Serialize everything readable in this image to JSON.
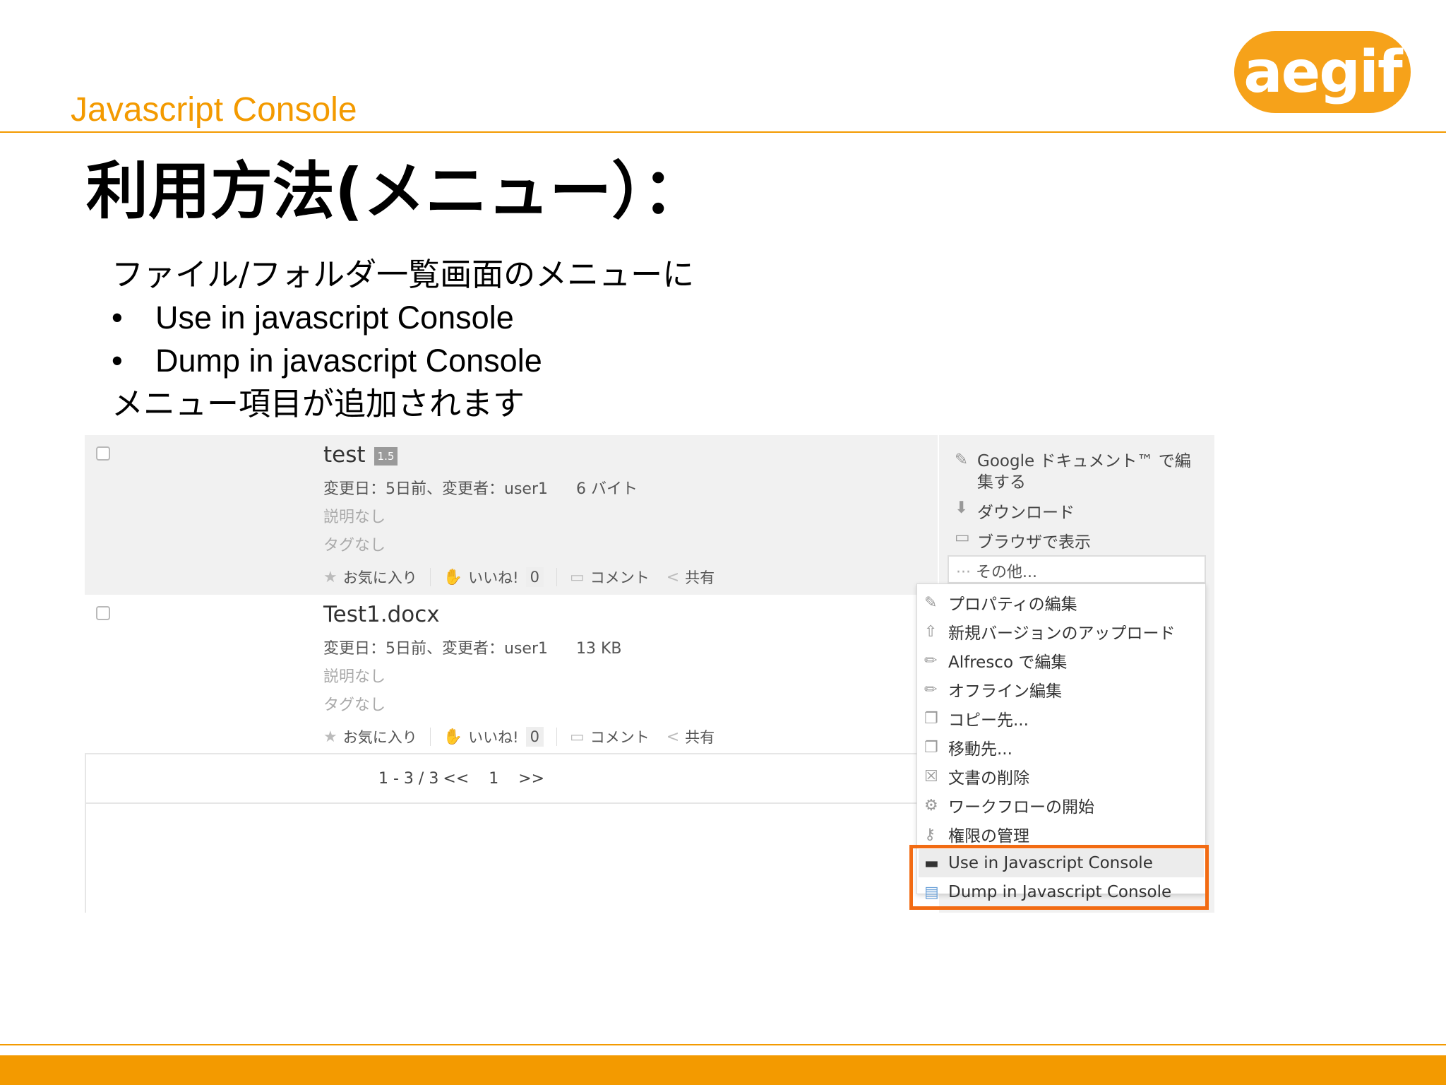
{
  "slide": {
    "subtitle": "Javascript Console",
    "logo_text": "aegif",
    "title": "利用方法(メニュー）：",
    "intro": "ファイル/フォルダ一覧画面のメニューに",
    "bullets": [
      "Use in javascript Console",
      "Dump in javascript Console"
    ],
    "outro": "メニュー項目が追加されます",
    "bullet_symbol": "•"
  },
  "colors": {
    "accent": "#f39a00",
    "highlight": "#f26b13"
  },
  "screenshot": {
    "files": [
      {
        "name": "test",
        "version": "1.5",
        "modified": "変更日：5日前、変更者：user1",
        "size": "6 バイト",
        "description": "説明なし",
        "tags": "タグなし",
        "favorite": "お気に入り",
        "like": "いいね!",
        "like_count": "0",
        "comment": "コメント",
        "share": "共有"
      },
      {
        "name": "Test1.docx",
        "modified": "変更日：5日前、変更者：user1",
        "size": "13 KB",
        "description": "説明なし",
        "tags": "タグなし",
        "favorite": "お気に入り",
        "like": "いいね!",
        "like_count": "0",
        "comment": "コメント",
        "share": "共有"
      }
    ],
    "pager": {
      "range": "1 - 3 / 3",
      "prev": "<<",
      "page": "1",
      "next": ">>"
    },
    "actions": {
      "google_edit_line1": "Google ドキュメント™ で編",
      "google_edit_line2": "集する",
      "download": "ダウンロード",
      "view_browser": "ブラウザで表示",
      "more": "その他..."
    },
    "menu": [
      "プロパティの編集",
      "新規バージョンのアップロード",
      "Alfresco で編集",
      "オフライン編集",
      "コピー先...",
      "移動先...",
      "文書の削除",
      "ワークフローの開始",
      "権限の管理",
      "Use in Javascript Console",
      "Dump in Javascript Console"
    ]
  }
}
